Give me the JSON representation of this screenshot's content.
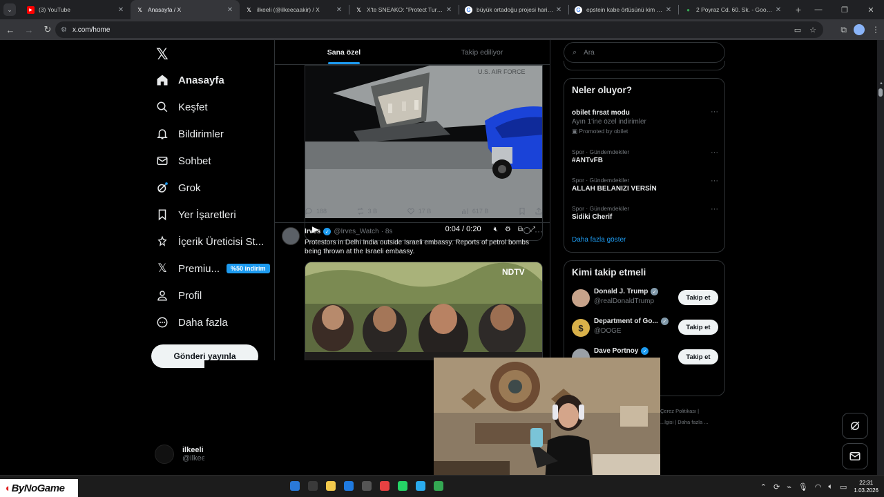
{
  "browser": {
    "tabs": [
      {
        "title": "(3) YouTube",
        "icon": "youtube-icon",
        "active": false
      },
      {
        "title": "Anasayfa / X",
        "icon": "x-icon",
        "active": true
      },
      {
        "title": "ilkeeli (@ilkeecaakir) / X",
        "icon": "x-icon",
        "active": false
      },
      {
        "title": "X'te SNEAKO: \"Protect Turkey a",
        "icon": "x-icon",
        "active": false
      },
      {
        "title": "büyük ortadoğu projesi haritası",
        "icon": "google-icon",
        "active": false
      },
      {
        "title": "epstein kabe örtüsünü kim satt",
        "icon": "google-icon",
        "active": false
      },
      {
        "title": "2 Poyraz Cd. 60. Sk. - Google H",
        "icon": "maps-icon",
        "active": false
      }
    ],
    "url": "x.com/home"
  },
  "sidebar": {
    "items": [
      {
        "label": "Anasayfa",
        "icon": "home-icon",
        "bold": true
      },
      {
        "label": "Keşfet",
        "icon": "search-icon"
      },
      {
        "label": "Bildirimler",
        "icon": "bell-icon"
      },
      {
        "label": "Sohbet",
        "icon": "envelope-icon"
      },
      {
        "label": "Grok",
        "icon": "grok-icon"
      },
      {
        "label": "Yer İşaretleri",
        "icon": "bookmark-icon"
      },
      {
        "label": "İçerik Üreticisi St...",
        "icon": "creator-studio-icon"
      },
      {
        "label": "Premiu...",
        "icon": "x-premium-icon",
        "badge": "%50 indirim"
      },
      {
        "label": "Profil",
        "icon": "person-icon"
      },
      {
        "label": "Daha fazla",
        "icon": "more-circle-icon"
      }
    ],
    "post_button": "Gönderi yayınla",
    "account": {
      "name": "ilkeeli",
      "handle": "@ilkeec"
    }
  },
  "feed": {
    "tabs": [
      "Sana özel",
      "Takip ediliyor"
    ],
    "video1": {
      "time": "0:04 / 0:20"
    },
    "actions1": {
      "replies": "188",
      "reposts": "3 B",
      "likes": "17 B",
      "views": "617 B"
    },
    "tweet2": {
      "name": "Irves",
      "handle": "@Irves_Watch",
      "time": "· 8s",
      "text": "Protestors in Delhi India outside Israeli embassy. Reports of petrol bombs being thrown at the Israeli embassy.",
      "watermark": "NDTV"
    }
  },
  "right": {
    "search_placeholder": "Ara",
    "trends_title": "Neler oluyor?",
    "trends": [
      {
        "meta": "",
        "name": "obilet fırsat modu",
        "desc": "Ayın 1'ine özel indirimler",
        "promo": "Promoted by obilet"
      },
      {
        "meta": "Spor · Gündemdekiler",
        "name": "#ANTvFB"
      },
      {
        "meta": "Spor · Gündemdekiler",
        "name": "ALLAH BELANIZI VERSİN"
      },
      {
        "meta": "Spor · Gündemdekiler",
        "name": "Sidiki Cherif"
      }
    ],
    "show_more": "Daha fazla göster",
    "follow_title": "Kimi takip etmeli",
    "follow": [
      {
        "name": "Donald J. Trump",
        "handle": "@realDonaldTrump",
        "button": "Takip et",
        "avatar_color": "#c7a38a"
      },
      {
        "name": "Department of Go...",
        "handle": "@DOGE",
        "button": "Takip et",
        "avatar_color": "#d9b14a"
      },
      {
        "name": "Dave Portnoy",
        "handle": "",
        "button": "Takip et",
        "avatar_color": "#9aa0a6"
      }
    ],
    "footer": [
      "Çerez Politikası |",
      "...lgisi | Daha fazla ..."
    ]
  },
  "taskbar": {
    "time": "22:31",
    "date": "1.03.2026",
    "brand": "ByNoGame"
  }
}
